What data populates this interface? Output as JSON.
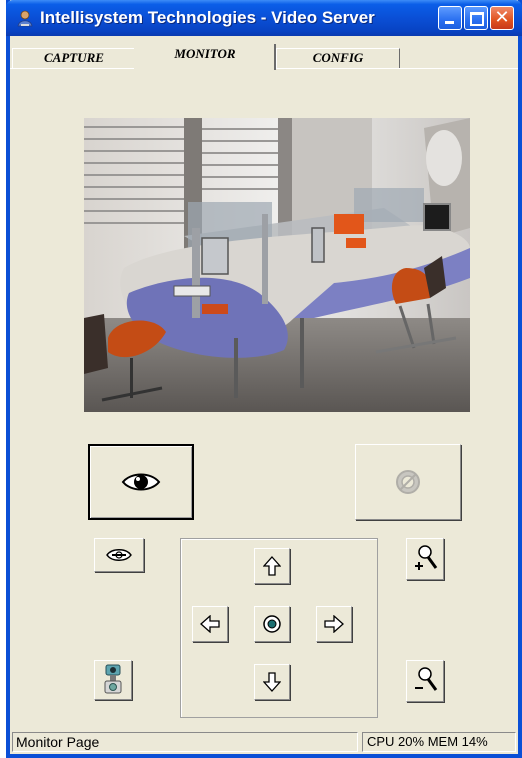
{
  "window": {
    "title": "Intellisystem Technologies - Video Server"
  },
  "tabs": [
    {
      "label": "CAPTURE"
    },
    {
      "label": "MONITOR",
      "selected": true
    },
    {
      "label": "CONFIG"
    }
  ],
  "controls": {
    "view_icon": "eye-icon",
    "disabled_icon": "disabled-eye-icon",
    "hide_icon": "hide-icon",
    "camera_icon": "camera-icon",
    "zoom_in_icon": "zoom-in-icon",
    "zoom_out_icon": "zoom-out-icon",
    "ptz": {
      "up": "up-arrow-icon",
      "down": "down-arrow-icon",
      "left": "left-arrow-icon",
      "right": "right-arrow-icon",
      "center": "center-icon"
    }
  },
  "status": {
    "left": "Monitor Page",
    "right": "CPU 20% MEM 14%"
  },
  "colors": {
    "title_bar": "#0a4fd6",
    "window_bg": "#ece9d8"
  }
}
